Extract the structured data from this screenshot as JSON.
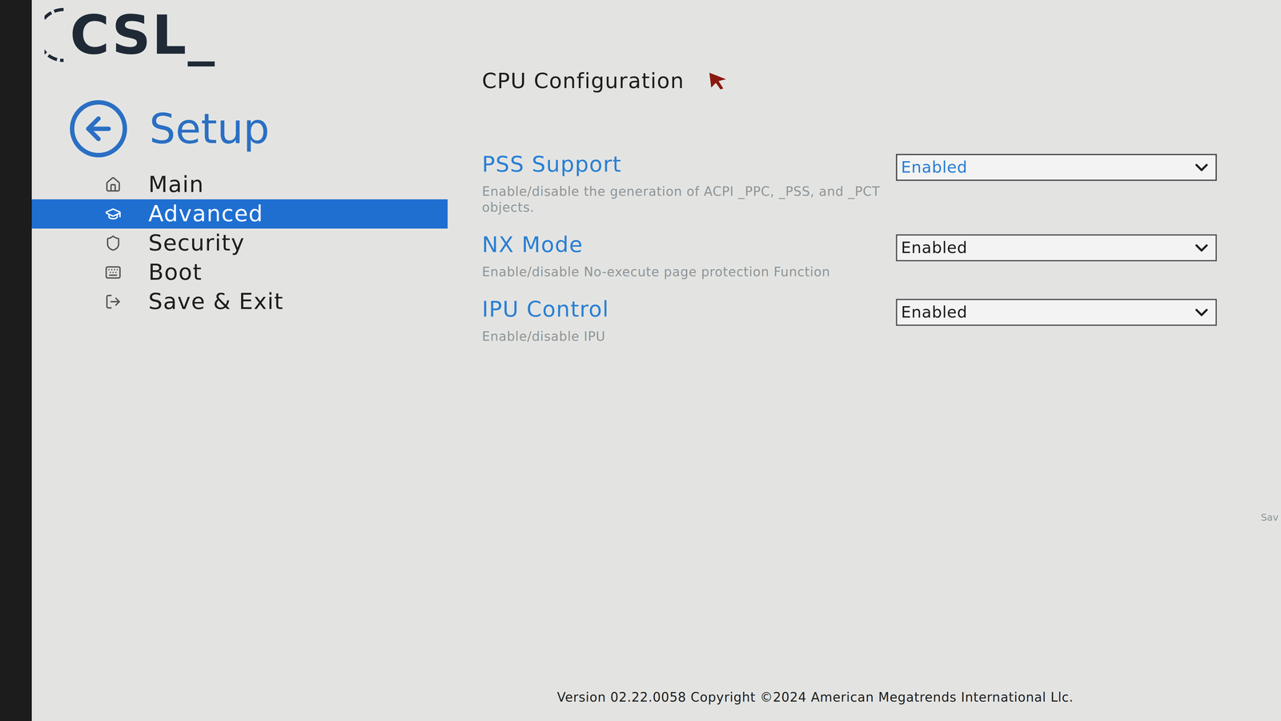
{
  "logo": {
    "text": "CSL_"
  },
  "header": {
    "title": "Setup"
  },
  "menu": [
    {
      "label": "Main",
      "selected": false
    },
    {
      "label": "Advanced",
      "selected": true
    },
    {
      "label": "Security",
      "selected": false
    },
    {
      "label": "Boot",
      "selected": false
    },
    {
      "label": "Save & Exit",
      "selected": false
    }
  ],
  "page": {
    "title": "CPU Configuration"
  },
  "settings": [
    {
      "label": "PSS Support",
      "description": "Enable/disable the generation of ACPI _PPC, _PSS, and _PCT objects.",
      "value": "Enabled",
      "focused": true
    },
    {
      "label": "NX Mode",
      "description": "Enable/disable No-execute page protection Function",
      "value": "Enabled",
      "focused": false
    },
    {
      "label": "IPU Control",
      "description": "Enable/disable IPU",
      "value": "Enabled",
      "focused": false
    }
  ],
  "footer": {
    "version": "Version 02.22.0058 Copyright ©2024 American Megatrends International Llc."
  },
  "edge_text": "Sav"
}
